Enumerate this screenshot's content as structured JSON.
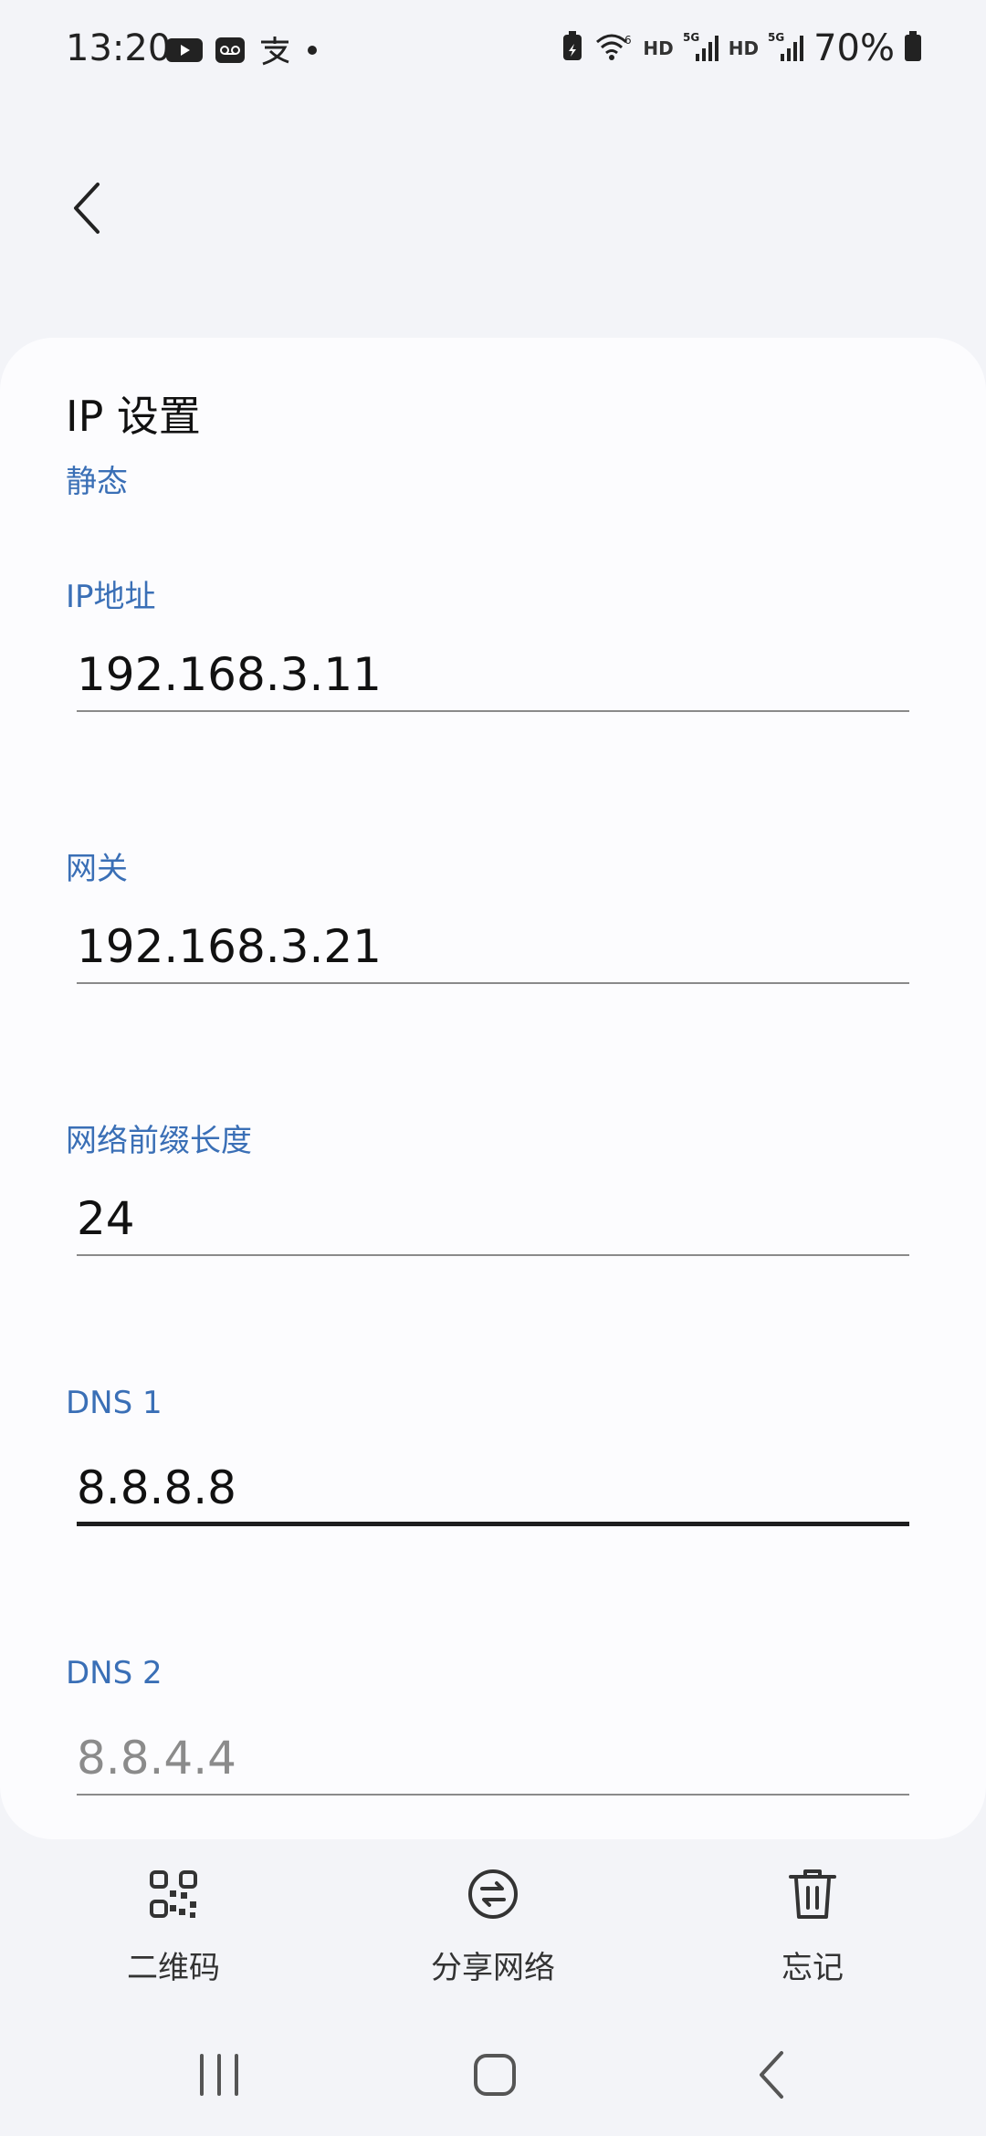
{
  "status_bar": {
    "time": "13:20",
    "hd1": "HD",
    "net1": "5G",
    "hd2": "HD",
    "net2": "5G",
    "battery": "70%"
  },
  "header": {
    "back_icon": "chevron-left-icon"
  },
  "ip_settings": {
    "title": "IP 设置",
    "mode": "静态"
  },
  "fields": [
    {
      "label": "IP地址",
      "value": "192.168.3.11",
      "state": "filled"
    },
    {
      "label": "网关",
      "value": "192.168.3.21",
      "state": "filled"
    },
    {
      "label": "网络前缀长度",
      "value": "24",
      "state": "filled"
    },
    {
      "label": "DNS 1",
      "value": "8.8.8.8",
      "state": "focused"
    },
    {
      "label": "DNS 2",
      "value": "8.8.4.4",
      "state": "placeholder"
    }
  ],
  "actions": [
    {
      "label": "二维码",
      "icon": "qr-code-icon"
    },
    {
      "label": "分享网络",
      "icon": "share-network-icon"
    },
    {
      "label": "忘记",
      "icon": "trash-icon"
    }
  ],
  "colors": {
    "accent": "#3a6fb6",
    "background": "#f3f4f8",
    "card": "#fcfcfe"
  }
}
